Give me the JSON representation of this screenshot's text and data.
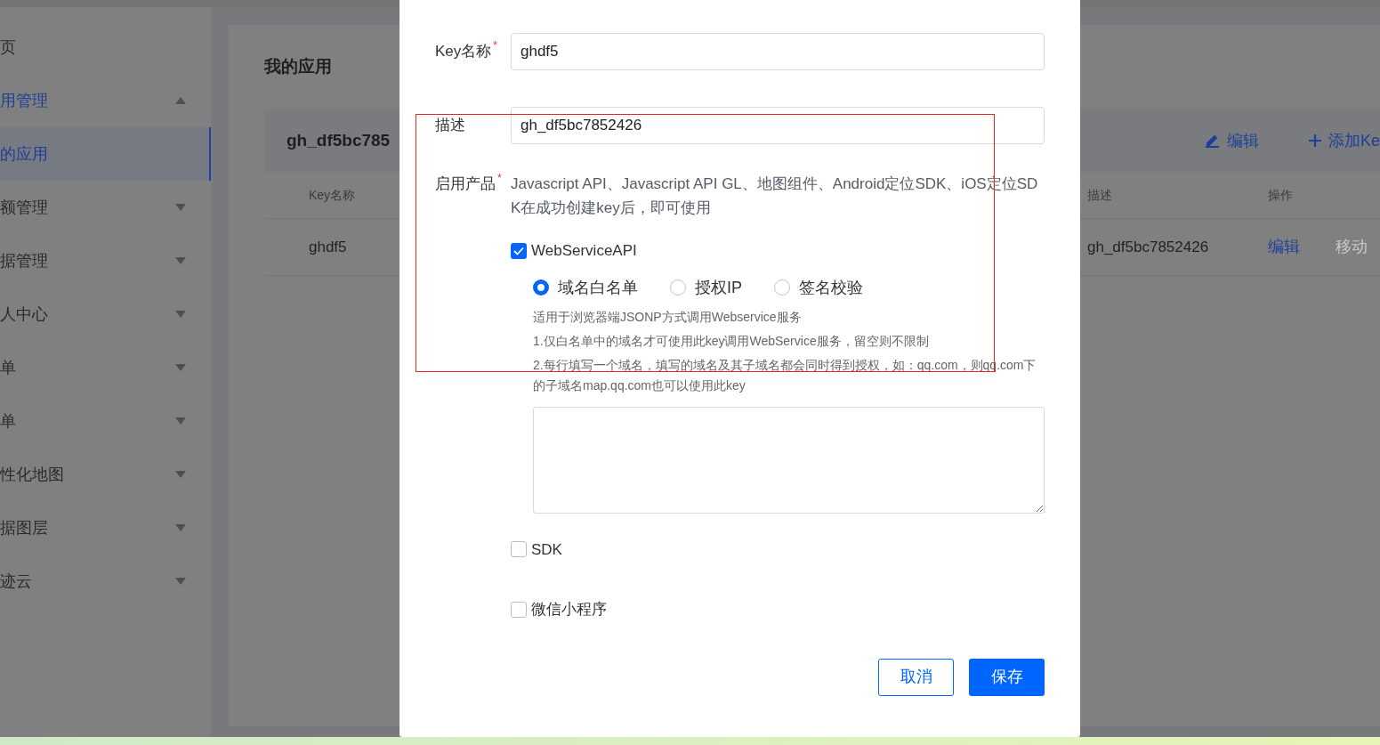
{
  "sidebar": {
    "items": [
      {
        "label": "页",
        "selected": false
      },
      {
        "label": "用管理",
        "expanded": true,
        "children": [
          {
            "label": "的应用",
            "selected": true
          }
        ]
      },
      {
        "label": "额管理",
        "expanded": false
      },
      {
        "label": "据管理",
        "expanded": false
      },
      {
        "label": "人中心",
        "expanded": false
      },
      {
        "label": "单",
        "expanded": false
      },
      {
        "label": "单",
        "expanded": false
      },
      {
        "label": "性化地图",
        "expanded": false
      },
      {
        "label": "据图层",
        "expanded": false
      },
      {
        "label": "迹云",
        "expanded": false
      }
    ]
  },
  "main": {
    "title": "我的应用",
    "app": {
      "name": "gh_df5bc785",
      "actions": [
        {
          "label": "编辑",
          "kind": "edit"
        },
        {
          "label": "添加Ke",
          "kind": "add"
        }
      ]
    },
    "table": {
      "columns": [
        "Key名称",
        "描述",
        "操作"
      ],
      "rows": [
        {
          "cells": [
            "ghdf5",
            "gh_df5bc7852426"
          ],
          "actions": [
            {
              "label": "编辑",
              "disabled": false
            },
            {
              "label": "移动",
              "disabled": true
            }
          ]
        }
      ]
    }
  },
  "dialog": {
    "fields": [
      {
        "label": "Key名称",
        "required_mark": "*",
        "value": "ghdf5"
      },
      {
        "label": "描述",
        "value": "gh_df5bc7852426"
      }
    ],
    "products": {
      "label": "启用产品",
      "required_mark": "*",
      "note": "Javascript API、Javascript API GL、地图组件、Android定位SDK、iOS定位SDK在成功创建key后，即可使用",
      "options": [
        {
          "label": "WebServiceAPI",
          "checked": true,
          "modes": [
            {
              "label": "域名白名单",
              "selected": true
            },
            {
              "label": "授权IP",
              "selected": false
            },
            {
              "label": "签名校验",
              "selected": false
            }
          ],
          "help": [
            "适用于浏览器端JSONP方式调用Webservice服务",
            "1.仅白名单中的域名才可使用此key调用WebService服务，留空则不限制",
            "2.每行填写一个域名，填写的域名及其子域名都会同时得到授权，如：qq.com，则qq.com下的子域名map.qq.com也可以使用此key"
          ]
        },
        {
          "label": "SDK",
          "checked": false
        },
        {
          "label": "微信小程序",
          "checked": false
        }
      ]
    },
    "buttons": [
      {
        "label": "取消",
        "kind": "secondary"
      },
      {
        "label": "保存",
        "kind": "primary"
      }
    ]
  }
}
